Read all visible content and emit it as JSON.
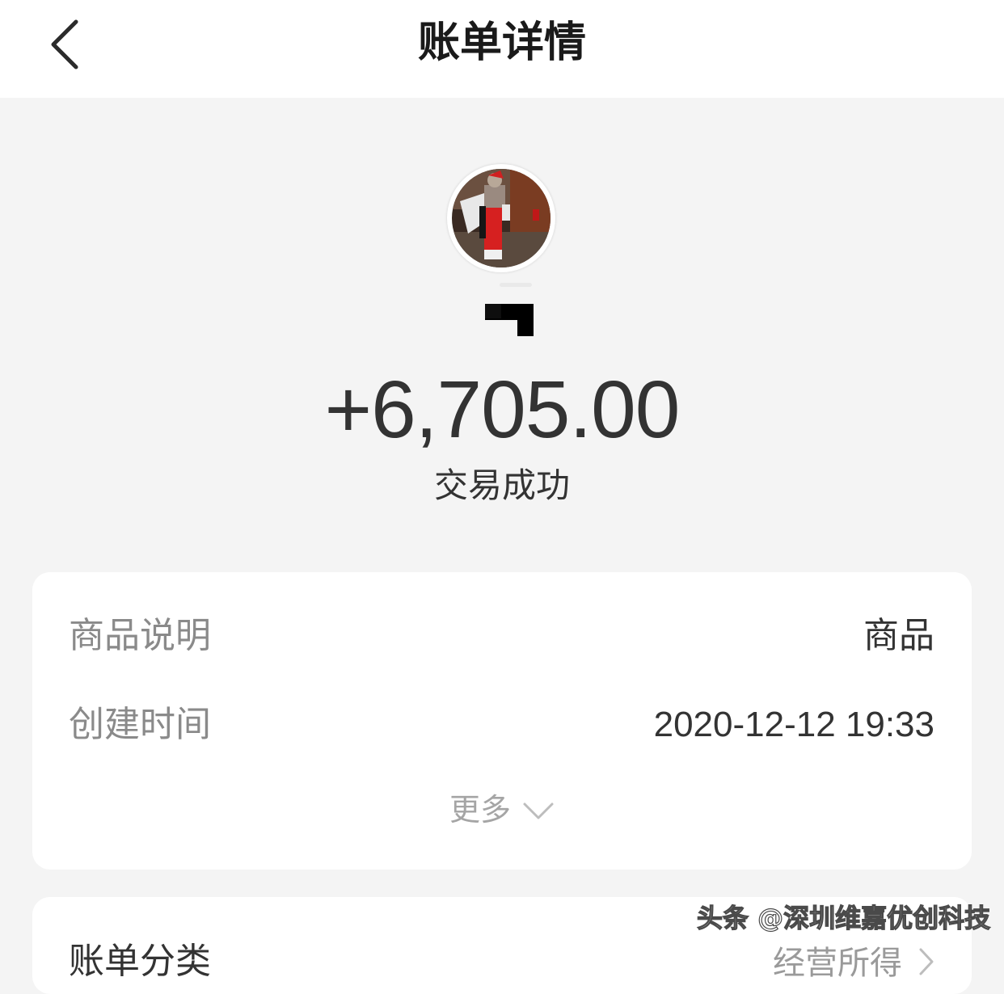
{
  "nav": {
    "title": "账单详情",
    "back_icon": "chevron-left-icon"
  },
  "header": {
    "avatar_icon": "user-avatar",
    "amount": "+6,705.00",
    "status": "交易成功"
  },
  "details": {
    "rows": [
      {
        "label": "商品说明",
        "value": "商品"
      },
      {
        "label": "创建时间",
        "value": "2020-12-12 19:33"
      }
    ],
    "more_label": "更多",
    "more_icon": "chevron-down-icon"
  },
  "category": {
    "label": "账单分类",
    "value": "经营所得",
    "chevron_icon": "chevron-right-icon"
  },
  "watermark": "头条 @深圳维嘉优创科技",
  "colors": {
    "background": "#f4f4f4",
    "card": "#ffffff",
    "primary_text": "#333333",
    "secondary_text": "#8a8a8a"
  }
}
